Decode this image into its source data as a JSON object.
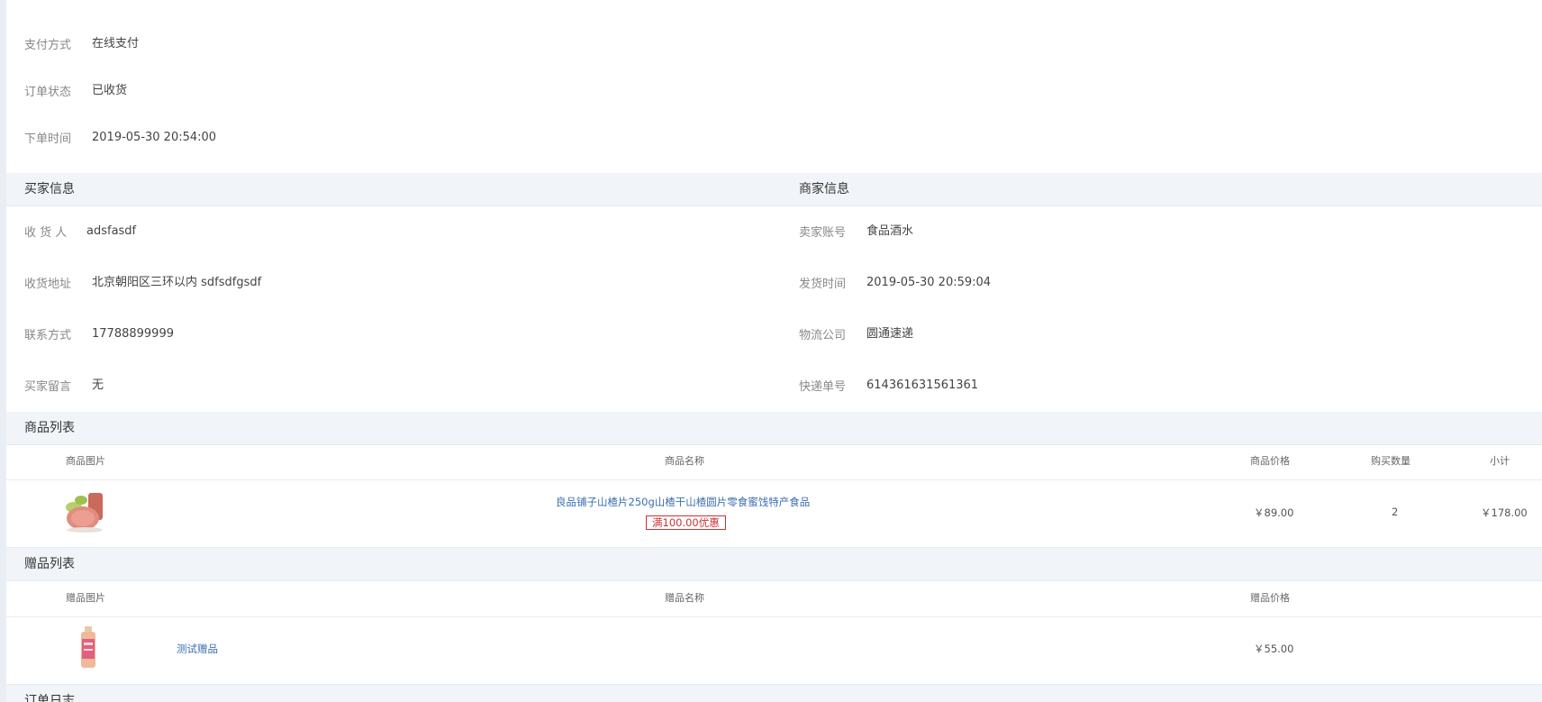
{
  "order": {
    "payment_method_label": "支付方式",
    "payment_method_value": "在线支付",
    "status_label": "订单状态",
    "status_value": "已收货",
    "order_time_label": "下单时间",
    "order_time_value": "2019-05-30 20:54:00"
  },
  "buyer": {
    "section_title": "买家信息",
    "receiver_label": "收 货 人",
    "receiver_value": "adsfasdf",
    "address_label": "收货地址",
    "address_value": "北京朝阳区三环以内 sdfsdfgsdf",
    "contact_label": "联系方式",
    "contact_value": "17788899999",
    "message_label": "买家留言",
    "message_value": "无"
  },
  "seller": {
    "section_title": "商家信息",
    "account_label": "卖家账号",
    "account_value": "食品酒水",
    "ship_time_label": "发货时间",
    "ship_time_value": "2019-05-30 20:59:04",
    "logistics_label": "物流公司",
    "logistics_value": "圆通速递",
    "tracking_label": "快递单号",
    "tracking_value": "614361631561361"
  },
  "products": {
    "section_title": "商品列表",
    "headers": [
      "商品图片",
      "商品名称",
      "商品价格",
      "购买数量",
      "小计"
    ],
    "rows": [
      {
        "name": "良品铺子山楂片250g山楂干山楂圆片零食蜜饯特产食品",
        "promo": "满100.00优惠",
        "price": "￥89.00",
        "quantity": "2",
        "subtotal": "￥178.00"
      }
    ]
  },
  "gifts": {
    "section_title": "赠品列表",
    "headers": [
      "赠品图片",
      "赠品名称",
      "赠品价格"
    ],
    "rows": [
      {
        "name": "测试赠品",
        "price": "￥55.00"
      }
    ]
  },
  "next_section": {
    "title": "订单日志"
  }
}
